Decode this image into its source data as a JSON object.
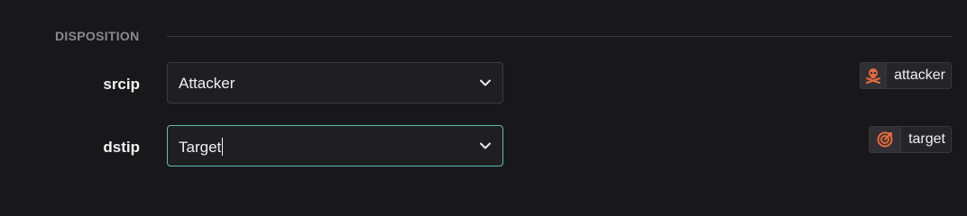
{
  "section": {
    "title": "DISPOSITION"
  },
  "rows": [
    {
      "label": "srcip",
      "value": "Attacker",
      "badge": {
        "text": "attacker",
        "icon": "skull-crossbones-icon"
      }
    },
    {
      "label": "dstip",
      "value": "Target",
      "badge": {
        "text": "target",
        "icon": "target-icon"
      }
    }
  ],
  "colors": {
    "accent_focus": "#5bbdb2",
    "badge_icon": "#e8693a",
    "background": "#18181a"
  }
}
